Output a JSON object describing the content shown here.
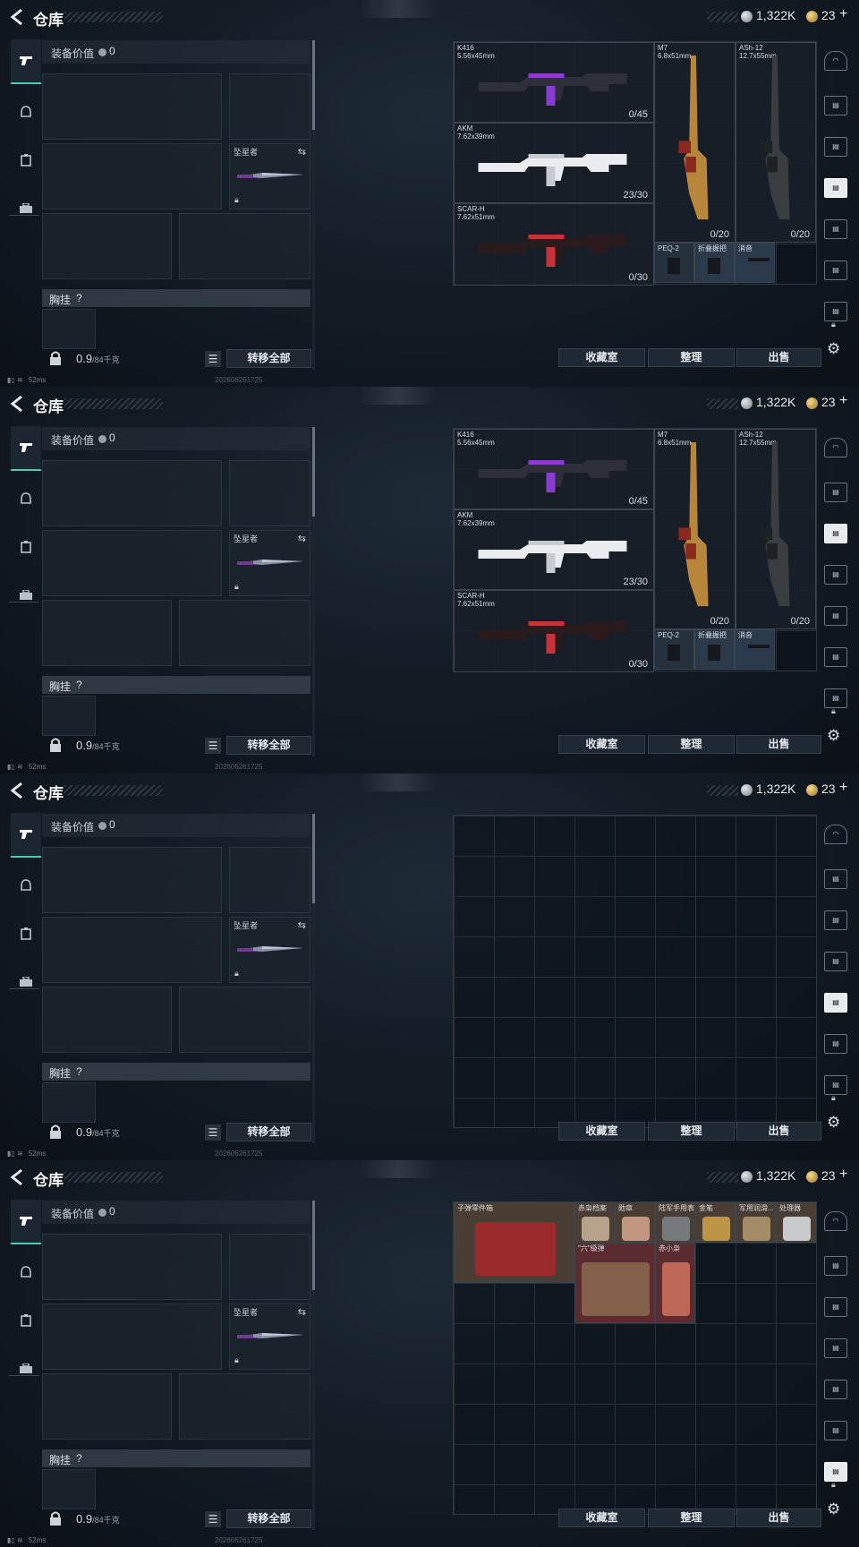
{
  "header": {
    "title": "仓库",
    "currency1": "1,322K",
    "currency2": "23",
    "plus": "+"
  },
  "equipment": {
    "value_label": "装备价值",
    "value": "0",
    "melee_label": "坠星者",
    "chest_label": "胸挂",
    "chest_help": "?",
    "weight": "0.9",
    "weight_max": "/84千克",
    "transfer_all": "转移全部"
  },
  "actions": {
    "collection": "收藏室",
    "sort": "整理",
    "sell": "出售"
  },
  "status": {
    "ping": "52ms",
    "timestamp": "202606261725"
  },
  "weapons": [
    {
      "name": "K416",
      "caliber": "5.56x45mm",
      "ammo": "0/45"
    },
    {
      "name": "M7",
      "caliber": "6.8x51mm",
      "ammo": "0/20"
    },
    {
      "name": "ASh-12",
      "caliber": "12.7x55mm",
      "ammo": "0/20"
    },
    {
      "name": "AKM",
      "caliber": "7.62x39mm",
      "ammo": "23/30"
    },
    {
      "name": "SCAR-H",
      "caliber": "7.62x51mm",
      "ammo": "0/30"
    }
  ],
  "attachments": [
    {
      "name": "PEQ-2"
    },
    {
      "name": "折叠握把"
    },
    {
      "name": "消音"
    }
  ],
  "collectibles": [
    {
      "name": "子弹零件箱"
    },
    {
      "name": "赤枭档案"
    },
    {
      "name": "勋章"
    },
    {
      "name": "陆军手用表"
    },
    {
      "name": "金笔"
    },
    {
      "name": "军用润滑..."
    },
    {
      "name": "处理器"
    },
    {
      "name": "\"六\"级弹"
    },
    {
      "name": "赤小枭"
    }
  ],
  "colors": {
    "accent": "#3fd1b0",
    "panel": "#131c25",
    "gold": "#c9962e"
  }
}
